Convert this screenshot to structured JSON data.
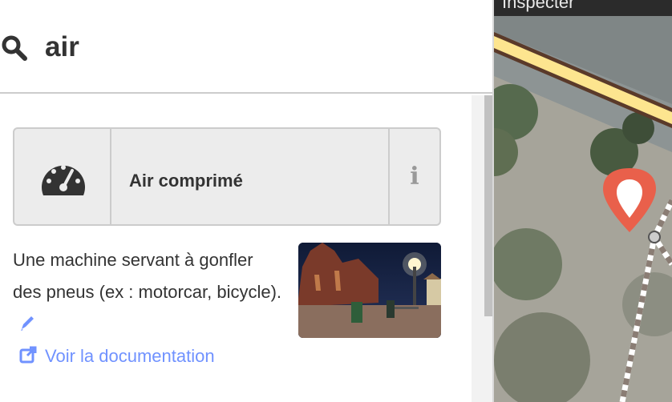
{
  "search": {
    "query": "air"
  },
  "preset": {
    "label": "Air comprimé",
    "info_glyph": "i",
    "icon": "gauge-icon"
  },
  "description": {
    "text": "Une machine servant à gonfler des pneus (ex : motorcar, bicycle)."
  },
  "documentation": {
    "label": "Voir la documentation"
  },
  "map": {
    "tab_label": "Inspecter"
  },
  "colors": {
    "link": "#7092ff",
    "pin": "#e9604b",
    "road": "#fde58f"
  }
}
